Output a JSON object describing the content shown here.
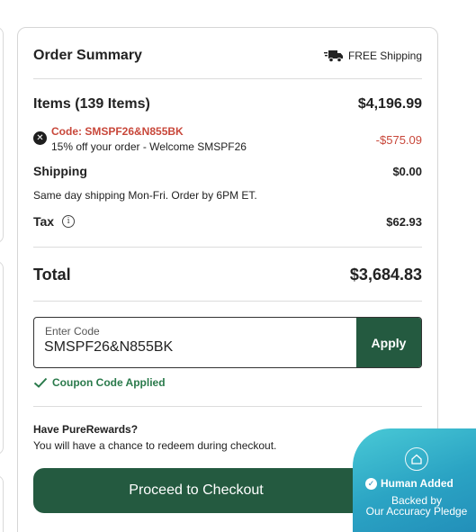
{
  "summary": {
    "title": "Order Summary",
    "shipping_badge": "FREE Shipping",
    "items_label": "Items (139 Items)",
    "items_value": "$4,196.99",
    "code_label": "Code: SMSPF26&N855BK",
    "code_desc": "15% off your order - Welcome SMSPF26",
    "code_value": "-$575.09",
    "shipping_label": "Shipping",
    "shipping_value": "$0.00",
    "shipping_note": "Same day shipping Mon-Fri. Order by 6PM ET.",
    "tax_label": "Tax",
    "tax_value": "$62.93",
    "total_label": "Total",
    "total_value": "$3,684.83"
  },
  "promo": {
    "input_label": "Enter Code",
    "input_value": "SMSPF26&N855BK",
    "apply_label": "Apply",
    "applied_text": "Coupon Code Applied"
  },
  "rewards": {
    "title": "Have PureRewards?",
    "desc": "You will have a chance to redeem during checkout."
  },
  "checkout": {
    "label": "Proceed to Checkout"
  },
  "badge": {
    "title": "Human Added",
    "line1": "Backed by",
    "line2": "Our Accuracy Pledge"
  },
  "colors": {
    "brand_green": "#245a40",
    "discount_red": "#c8473a",
    "success_green": "#2a7a4b",
    "badge_teal": "#2ba4c4"
  },
  "icons": [
    "truck-icon",
    "remove-icon",
    "info-icon",
    "check-icon",
    "home-icon",
    "verify-icon"
  ]
}
